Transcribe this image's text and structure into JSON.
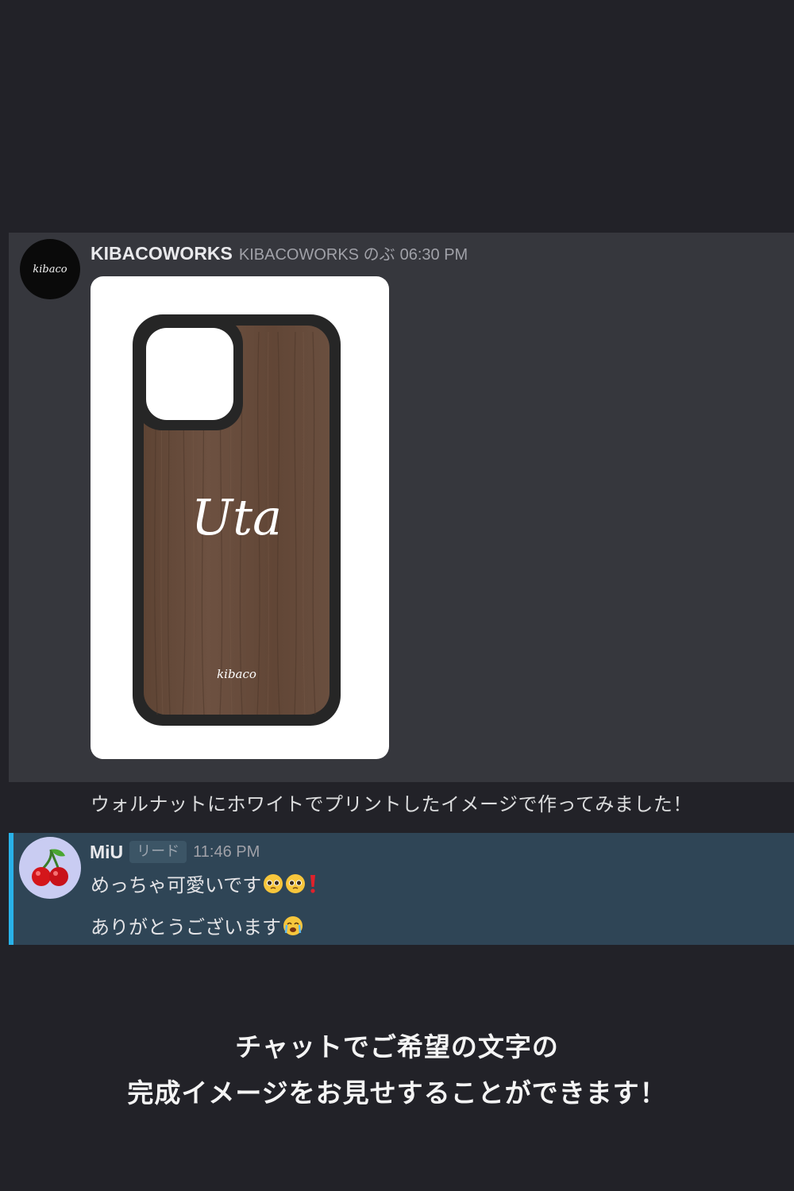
{
  "message1": {
    "username": "KIBACOWORKS",
    "handle": "KIBACOWORKS のぶ",
    "timestamp": "06:30 PM",
    "avatar_text": "kibaco",
    "image": {
      "case_engraving": "Uta",
      "case_logo": "kibaco",
      "case_material_color": "#6b4e3c"
    },
    "text": "ウォルナットにホワイトでプリントしたイメージで作ってみました！"
  },
  "message2": {
    "username": "MiU",
    "role": "リード",
    "timestamp": "11:46 PM",
    "avatar_icon": "cherry-icon",
    "line1": "めっちゃ可愛いです",
    "line2": "ありがとうございます",
    "highlight_color": "#29b2e9"
  },
  "caption": {
    "line1": "チャットでご希望の文字の",
    "line2": "完成イメージをお見せすることができます！"
  }
}
